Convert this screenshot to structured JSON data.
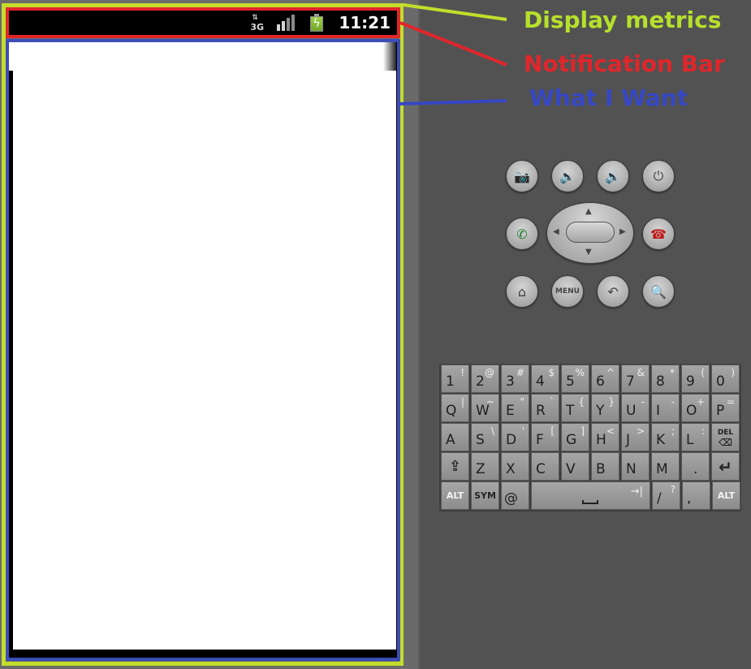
{
  "status_bar": {
    "network_label": "3G",
    "time": "11:21",
    "icons": [
      "data-arrows-icon",
      "signal-icon",
      "battery-charging-icon"
    ],
    "signal_bars_on": 2,
    "signal_bars_total": 4
  },
  "annotations": [
    {
      "label": "Display metrics",
      "color": "#b6e02c"
    },
    {
      "label": "Notification Bar",
      "color": "#e0262b"
    },
    {
      "label": "What I Want",
      "color": "#3547c4"
    }
  ],
  "hardware_buttons": {
    "row1": [
      "camera",
      "volume-down",
      "volume-up",
      "power"
    ],
    "row2": [
      "call",
      "dpad",
      "end-call"
    ],
    "row3": [
      "home",
      "menu",
      "back",
      "search"
    ],
    "menu_label": "MENU"
  },
  "keyboard": {
    "rows": [
      [
        [
          "1",
          "!"
        ],
        [
          "2",
          "@"
        ],
        [
          "3",
          "#"
        ],
        [
          "4",
          "$"
        ],
        [
          "5",
          "%"
        ],
        [
          "6",
          "^"
        ],
        [
          "7",
          "&"
        ],
        [
          "8",
          "*"
        ],
        [
          "9",
          "("
        ],
        [
          "0",
          ")"
        ]
      ],
      [
        [
          "Q",
          "|"
        ],
        [
          "W",
          "~"
        ],
        [
          "E",
          "\""
        ],
        [
          "R",
          "`"
        ],
        [
          "T",
          "{"
        ],
        [
          "Y",
          "}"
        ],
        [
          "U",
          "-"
        ],
        [
          "I",
          "-"
        ],
        [
          "O",
          "+"
        ],
        [
          "P",
          "="
        ]
      ],
      [
        [
          "A",
          ""
        ],
        [
          "S",
          "\\"
        ],
        [
          "D",
          "'"
        ],
        [
          "F",
          "["
        ],
        [
          "G",
          "]"
        ],
        [
          "H",
          "<"
        ],
        [
          "J",
          ">"
        ],
        [
          "K",
          ";"
        ],
        [
          "L",
          ":"
        ],
        [
          "DEL",
          ""
        ]
      ],
      [
        [
          "SHIFT",
          ""
        ],
        [
          "Z",
          ""
        ],
        [
          "X",
          ""
        ],
        [
          "C",
          ""
        ],
        [
          "V",
          ""
        ],
        [
          "B",
          ""
        ],
        [
          "N",
          ""
        ],
        [
          "M",
          ""
        ],
        [
          ".",
          ""
        ],
        [
          "ENTER",
          ""
        ]
      ],
      [
        [
          "ALT",
          ""
        ],
        [
          "SYM",
          ""
        ],
        [
          "@",
          ""
        ],
        [
          "SPACE",
          "→|"
        ],
        [
          "/",
          "?"
        ],
        [
          ",",
          ""
        ],
        [
          "ALT",
          ""
        ]
      ]
    ]
  }
}
